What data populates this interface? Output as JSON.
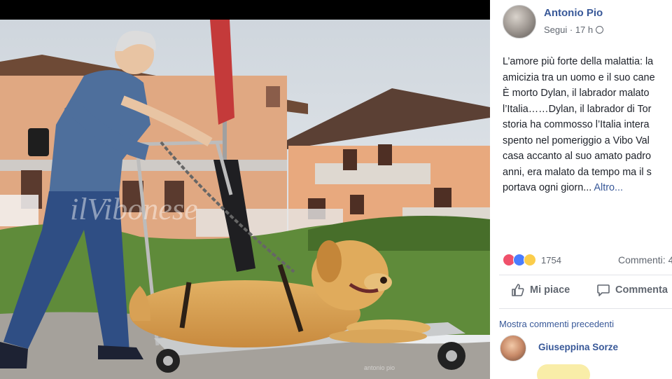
{
  "post": {
    "author": "Antonio Pio",
    "follow_label": "Segui",
    "separator": " · ",
    "time": "17 h",
    "privacy_icon": "globe-icon",
    "text_lines": [
      "L’amore più forte della malattia: la",
      "amicizia tra un uomo e il suo cane",
      "È morto Dylan, il labrador malato",
      "l’Italia……Dylan, il labrador di Tor",
      "storia ha commosso l’Italia intera",
      "spento nel pomeriggio a Vibo Val",
      "casa accanto al suo amato padro",
      "anni, era malato da tempo ma il s",
      "portava ogni giorn... "
    ],
    "more_label": "Altro..."
  },
  "reactions": {
    "icons": [
      "love-reaction-icon",
      "like-reaction-icon",
      "sad-reaction-icon"
    ],
    "count": "1754",
    "comments_label": "Commenti: 4"
  },
  "actions": {
    "like_label": "Mi piace",
    "comment_label": "Commenta"
  },
  "comments": {
    "previous_label": "Mostra commenti precedenti",
    "commenter_name": "Giuseppina Sorze"
  },
  "photo": {
    "watermark": "ilVibonese",
    "credit": "antonio pio"
  },
  "colors": {
    "link_blue": "#385898",
    "text": "#1d2129",
    "secondary": "#616770",
    "love": "#f0516b",
    "like": "#4a7dff",
    "sad": "#fbcd4b"
  }
}
